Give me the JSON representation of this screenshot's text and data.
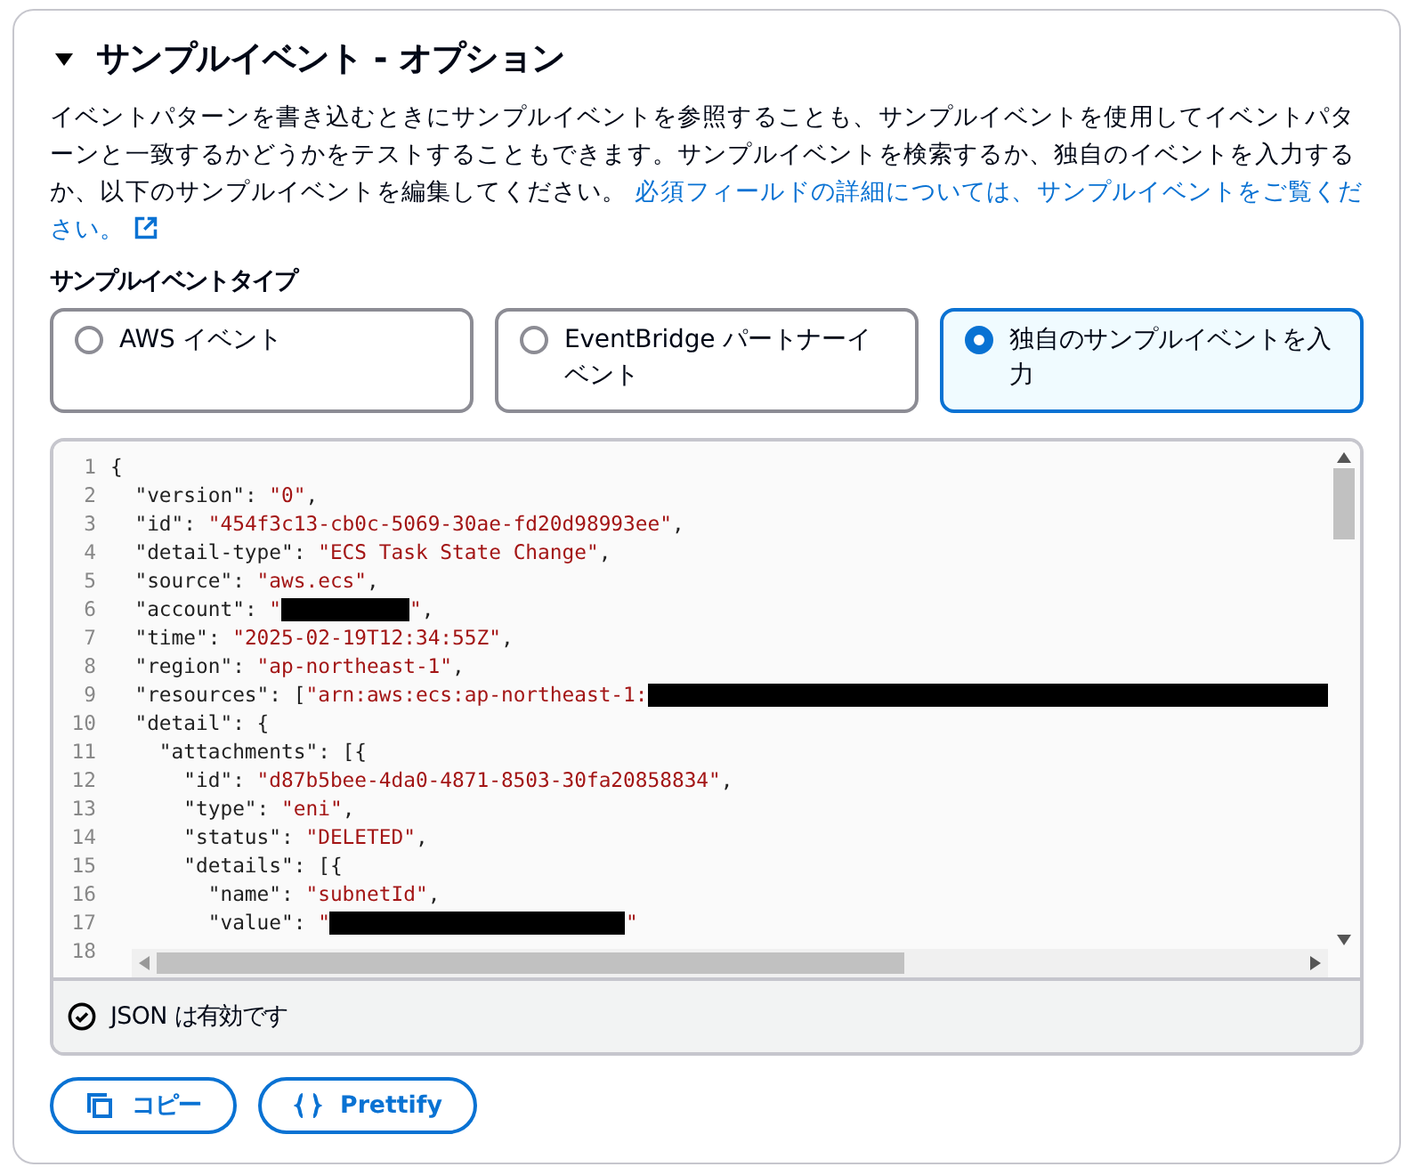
{
  "section": {
    "title": "サンプルイベント - オプション",
    "expanded": true,
    "description": "イベントパターンを書き込むときにサンプルイベントを参照することも、サンプルイベントを使用してイベントパターンと一致するかどうかをテストすることもできます。サンプルイベントを検索するか、独自のイベントを入力するか、以下のサンプルイベントを編集してください。",
    "link": [
      "必須フィールドの詳細については、サンプルイベントをご覧くだ",
      "さい。"
    ]
  },
  "event_type": {
    "label": "サンプルイベントタイプ",
    "options": [
      {
        "label": "AWS イベント",
        "selected": false
      },
      {
        "label": "EventBridge パートナーイベント",
        "selected": false
      },
      {
        "label": "独自のサンプルイベントを入力",
        "selected": true
      }
    ]
  },
  "editor": {
    "lines": [
      {
        "number": "1",
        "segments": [
          {
            "kind": "punct",
            "text": "{"
          }
        ]
      },
      {
        "number": "2",
        "segments": [
          {
            "kind": "key",
            "text": "  \"version\""
          },
          {
            "kind": "punct",
            "text": ": "
          },
          {
            "kind": "string",
            "text": "\"0\""
          },
          {
            "kind": "punct",
            "text": ","
          }
        ]
      },
      {
        "number": "3",
        "segments": [
          {
            "kind": "key",
            "text": "  \"id\""
          },
          {
            "kind": "punct",
            "text": ": "
          },
          {
            "kind": "string",
            "text": "\"454f3c13-cb0c-5069-30ae-fd20d98993ee\""
          },
          {
            "kind": "punct",
            "text": ","
          }
        ]
      },
      {
        "number": "4",
        "segments": [
          {
            "kind": "key",
            "text": "  \"detail-type\""
          },
          {
            "kind": "punct",
            "text": ": "
          },
          {
            "kind": "string",
            "text": "\"ECS Task State Change\""
          },
          {
            "kind": "punct",
            "text": ","
          }
        ]
      },
      {
        "number": "5",
        "segments": [
          {
            "kind": "key",
            "text": "  \"source\""
          },
          {
            "kind": "punct",
            "text": ": "
          },
          {
            "kind": "string",
            "text": "\"aws.ecs\""
          },
          {
            "kind": "punct",
            "text": ","
          }
        ]
      },
      {
        "number": "6",
        "segments": [
          {
            "kind": "key",
            "text": "  \"account\""
          },
          {
            "kind": "punct",
            "text": ": "
          },
          {
            "kind": "string",
            "text": "\""
          },
          {
            "kind": "redacted"
          },
          {
            "kind": "string",
            "text": "\""
          },
          {
            "kind": "punct",
            "text": ","
          }
        ]
      },
      {
        "number": "7",
        "segments": [
          {
            "kind": "key",
            "text": "  \"time\""
          },
          {
            "kind": "punct",
            "text": ": "
          },
          {
            "kind": "string",
            "text": "\"2025-02-19T12:34:55Z\""
          },
          {
            "kind": "punct",
            "text": ","
          }
        ]
      },
      {
        "number": "8",
        "segments": [
          {
            "kind": "key",
            "text": "  \"region\""
          },
          {
            "kind": "punct",
            "text": ": "
          },
          {
            "kind": "string",
            "text": "\"ap-northeast-1\""
          },
          {
            "kind": "punct",
            "text": ","
          }
        ]
      },
      {
        "number": "9",
        "segments": [
          {
            "kind": "key",
            "text": "  \"resources\""
          },
          {
            "kind": "punct",
            "text": ": ["
          },
          {
            "kind": "string",
            "text": "\"arn:aws:ecs:ap-northeast-1:"
          },
          {
            "kind": "redacted"
          }
        ]
      },
      {
        "number": "10",
        "segments": [
          {
            "kind": "key",
            "text": "  \"detail\""
          },
          {
            "kind": "punct",
            "text": ": {"
          }
        ]
      },
      {
        "number": "11",
        "segments": [
          {
            "kind": "key",
            "text": "    \"attachments\""
          },
          {
            "kind": "punct",
            "text": ": [{"
          }
        ]
      },
      {
        "number": "12",
        "segments": [
          {
            "kind": "key",
            "text": "      \"id\""
          },
          {
            "kind": "punct",
            "text": ": "
          },
          {
            "kind": "string",
            "text": "\"d87b5bee-4da0-4871-8503-30fa20858834\""
          },
          {
            "kind": "punct",
            "text": ","
          }
        ]
      },
      {
        "number": "13",
        "segments": [
          {
            "kind": "key",
            "text": "      \"type\""
          },
          {
            "kind": "punct",
            "text": ": "
          },
          {
            "kind": "string",
            "text": "\"eni\""
          },
          {
            "kind": "punct",
            "text": ","
          }
        ]
      },
      {
        "number": "14",
        "segments": [
          {
            "kind": "key",
            "text": "      \"status\""
          },
          {
            "kind": "punct",
            "text": ": "
          },
          {
            "kind": "string",
            "text": "\"DELETED\""
          },
          {
            "kind": "punct",
            "text": ","
          }
        ]
      },
      {
        "number": "15",
        "segments": [
          {
            "kind": "key",
            "text": "      \"details\""
          },
          {
            "kind": "punct",
            "text": ": [{"
          }
        ]
      },
      {
        "number": "16",
        "segments": [
          {
            "kind": "key",
            "text": "        \"name\""
          },
          {
            "kind": "punct",
            "text": ": "
          },
          {
            "kind": "string",
            "text": "\"subnetId\""
          },
          {
            "kind": "punct",
            "text": ","
          }
        ]
      },
      {
        "number": "17",
        "segments": [
          {
            "kind": "key",
            "text": "        \"value\""
          },
          {
            "kind": "punct",
            "text": ": "
          },
          {
            "kind": "string",
            "text": "\""
          },
          {
            "kind": "redacted"
          },
          {
            "kind": "string",
            "text": "\""
          }
        ]
      },
      {
        "number": "18"
      }
    ],
    "status": "JSON は有効です",
    "valid": true
  },
  "buttons": [
    {
      "label": "コピー",
      "kind": "copy"
    },
    {
      "label": "Prettify",
      "kind": "prettify"
    }
  ]
}
